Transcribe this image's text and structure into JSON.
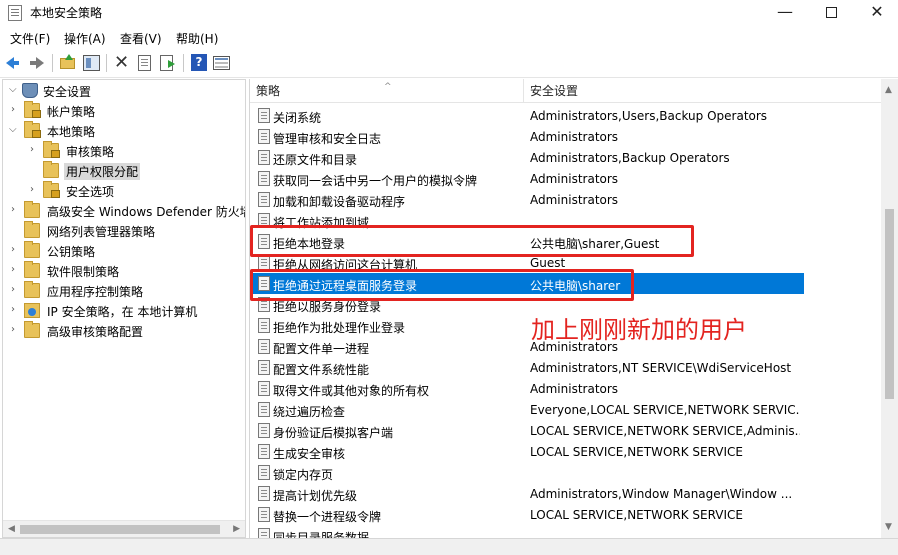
{
  "window": {
    "title": "本地安全策略"
  },
  "menu": [
    {
      "label": "文件(F)"
    },
    {
      "label": "操作(A)"
    },
    {
      "label": "查看(V)"
    },
    {
      "label": "帮助(H)"
    }
  ],
  "toolbar": {
    "buttons": [
      "back-icon",
      "forward-icon",
      "up-folder-icon",
      "show-tree-icon",
      "delete-icon",
      "properties-icon",
      "export-icon",
      "help-icon",
      "view-icon"
    ]
  },
  "tree": {
    "root": "安全设置",
    "items": [
      {
        "label": "安全设置",
        "level": 0,
        "expanded": true
      },
      {
        "label": "帐户策略",
        "level": 1
      },
      {
        "label": "本地策略",
        "level": 1,
        "expanded": true
      },
      {
        "label": "审核策略",
        "level": 2
      },
      {
        "label": "用户权限分配",
        "level": 2,
        "selected": true
      },
      {
        "label": "安全选项",
        "level": 2
      },
      {
        "label": "高级安全 Windows Defender 防火墙",
        "level": 1
      },
      {
        "label": "网络列表管理器策略",
        "level": 1
      },
      {
        "label": "公钥策略",
        "level": 1
      },
      {
        "label": "软件限制策略",
        "level": 1
      },
      {
        "label": "应用程序控制策略",
        "level": 1
      },
      {
        "label": "IP 安全策略，在 本地计算机",
        "level": 1
      },
      {
        "label": "高级审核策略配置",
        "level": 1
      }
    ]
  },
  "list": {
    "columns": [
      "策略",
      "安全设置"
    ],
    "rows": [
      {
        "policy": "关闭系统",
        "setting": "Administrators,Users,Backup Operators"
      },
      {
        "policy": "管理审核和安全日志",
        "setting": "Administrators"
      },
      {
        "policy": "还原文件和目录",
        "setting": "Administrators,Backup Operators"
      },
      {
        "policy": "获取同一会话中另一个用户的模拟令牌",
        "setting": "Administrators"
      },
      {
        "policy": "加载和卸载设备驱动程序",
        "setting": "Administrators"
      },
      {
        "policy": "将工作站添加到域",
        "setting": ""
      },
      {
        "policy": "拒绝本地登录",
        "setting": "公共电脑\\sharer,Guest"
      },
      {
        "policy": "拒绝从网络访问这台计算机",
        "setting": "Guest"
      },
      {
        "policy": "拒绝通过远程桌面服务登录",
        "setting": "公共电脑\\sharer",
        "selected": true
      },
      {
        "policy": "拒绝以服务身份登录",
        "setting": ""
      },
      {
        "policy": "拒绝作为批处理作业登录",
        "setting": ""
      },
      {
        "policy": "配置文件单一进程",
        "setting": "Administrators"
      },
      {
        "policy": "配置文件系统性能",
        "setting": "Administrators,NT SERVICE\\WdiServiceHost"
      },
      {
        "policy": "取得文件或其他对象的所有权",
        "setting": "Administrators"
      },
      {
        "policy": "绕过遍历检查",
        "setting": "Everyone,LOCAL SERVICE,NETWORK SERVIC..."
      },
      {
        "policy": "身份验证后模拟客户端",
        "setting": "LOCAL SERVICE,NETWORK SERVICE,Adminis..."
      },
      {
        "policy": "生成安全审核",
        "setting": "LOCAL SERVICE,NETWORK SERVICE"
      },
      {
        "policy": "锁定内存页",
        "setting": ""
      },
      {
        "policy": "提高计划优先级",
        "setting": "Administrators,Window Manager\\Window ..."
      },
      {
        "policy": "替换一个进程级令牌",
        "setting": "LOCAL SERVICE,NETWORK SERVICE"
      },
      {
        "policy": "同步目录服务数据",
        "setting": ""
      }
    ]
  },
  "annotation": {
    "text": "加上刚刚新加的用户",
    "color": "#e32420"
  },
  "colors": {
    "selection": "#0078d7",
    "highlight_box": "#e32420"
  }
}
